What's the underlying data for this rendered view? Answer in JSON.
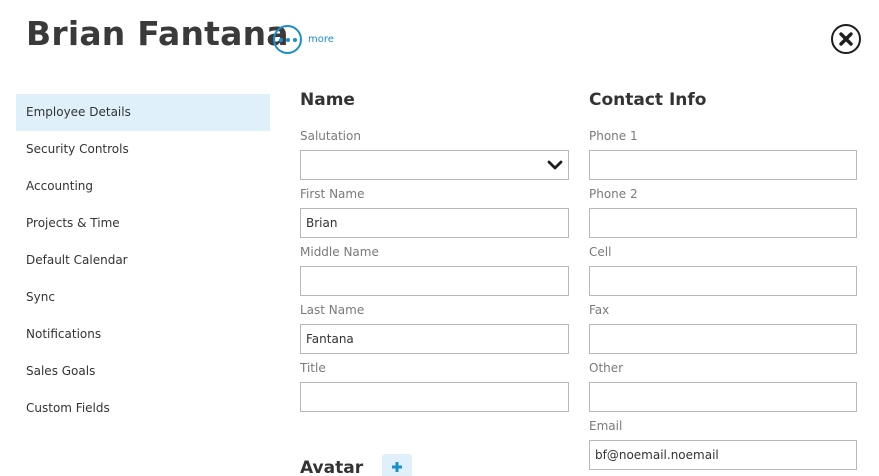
{
  "header": {
    "title": "Brian Fantana",
    "more_label": "more"
  },
  "sidebar": {
    "items": [
      {
        "label": "Employee Details",
        "active": true
      },
      {
        "label": "Security Controls"
      },
      {
        "label": "Accounting"
      },
      {
        "label": "Projects & Time"
      },
      {
        "label": "Default Calendar"
      },
      {
        "label": "Sync"
      },
      {
        "label": "Notifications"
      },
      {
        "label": "Sales Goals"
      },
      {
        "label": "Custom Fields"
      }
    ]
  },
  "name_section": {
    "heading": "Name",
    "salutation": {
      "label": "Salutation",
      "value": ""
    },
    "first_name": {
      "label": "First Name",
      "value": "Brian"
    },
    "middle_name": {
      "label": "Middle Name",
      "value": ""
    },
    "last_name": {
      "label": "Last Name",
      "value": "Fantana"
    },
    "title": {
      "label": "Title",
      "value": ""
    }
  },
  "contact_section": {
    "heading": "Contact Info",
    "phone1": {
      "label": "Phone 1",
      "value": ""
    },
    "phone2": {
      "label": "Phone 2",
      "value": ""
    },
    "cell": {
      "label": "Cell",
      "value": ""
    },
    "fax": {
      "label": "Fax",
      "value": ""
    },
    "other": {
      "label": "Other",
      "value": ""
    },
    "email": {
      "label": "Email",
      "value": "bf@noemail.noemail"
    }
  },
  "avatar_section": {
    "heading": "Avatar"
  },
  "colors": {
    "accent": "#1a8fc9",
    "active_bg": "#dff0fa"
  }
}
